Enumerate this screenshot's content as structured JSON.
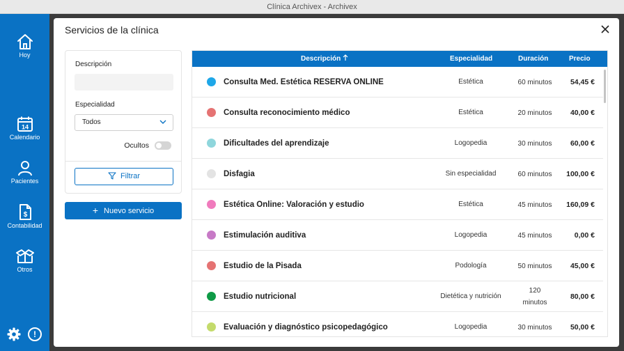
{
  "window": {
    "title": "Clínica Archivex - Archivex"
  },
  "sidebar": {
    "items": [
      {
        "label": "Hoy",
        "icon": "home-icon"
      },
      {
        "label": "Calendario",
        "icon": "calendar-icon",
        "badge": "14"
      },
      {
        "label": "Pacientes",
        "icon": "user-icon"
      },
      {
        "label": "Contabilidad",
        "icon": "invoice-dollar-icon"
      },
      {
        "label": "Otros",
        "icon": "box-icon"
      }
    ],
    "info_glyph": "!"
  },
  "modal": {
    "title": "Servicios de la clínica"
  },
  "filters": {
    "description_label": "Descripción",
    "description_value": "",
    "specialty_label": "Especialidad",
    "specialty_value": "Todos",
    "hidden_label": "Ocultos",
    "filter_button": "Filtrar"
  },
  "new_service_button": "Nuevo servicio",
  "table": {
    "columns": {
      "description": "Descripción",
      "specialty": "Especialidad",
      "duration": "Duración",
      "price": "Precio"
    },
    "rows": [
      {
        "color": "#1ea7e8",
        "name": "Consulta Med. Estética RESERVA ONLINE",
        "specialty": "Estética",
        "duration": "60 minutos",
        "price": "54,45 €"
      },
      {
        "color": "#e57373",
        "name": "Consulta reconocimiento médico",
        "specialty": "Estética",
        "duration": "20 minutos",
        "price": "40,00 €"
      },
      {
        "color": "#8fd6dc",
        "name": "Dificultades del aprendizaje",
        "specialty": "Logopedia",
        "duration": "30 minutos",
        "price": "60,00 €"
      },
      {
        "color": "#e3e3e3",
        "name": "Disfagia",
        "specialty": "Sin especialidad",
        "duration": "60 minutos",
        "price": "100,00 €"
      },
      {
        "color": "#f07bbd",
        "name": "Estética Online: Valoración y estudio",
        "specialty": "Estética",
        "duration": "45 minutos",
        "price": "160,09 €"
      },
      {
        "color": "#c77ac6",
        "name": "Estimulación auditiva",
        "specialty": "Logopedia",
        "duration": "45 minutos",
        "price": "0,00 €"
      },
      {
        "color": "#e57373",
        "name": "Estudio de la Pisada",
        "specialty": "Podología",
        "duration": "50 minutos",
        "price": "45,00 €"
      },
      {
        "color": "#0e9a46",
        "name": "Estudio nutricional",
        "specialty": "Dietética y nutrición",
        "duration": "120 minutos",
        "price": "80,00 €"
      },
      {
        "color": "#c4db6c",
        "name": "Evaluación y diagnóstico psicopedagógico",
        "specialty": "Logopedia",
        "duration": "30 minutos",
        "price": "50,00 €"
      }
    ]
  }
}
